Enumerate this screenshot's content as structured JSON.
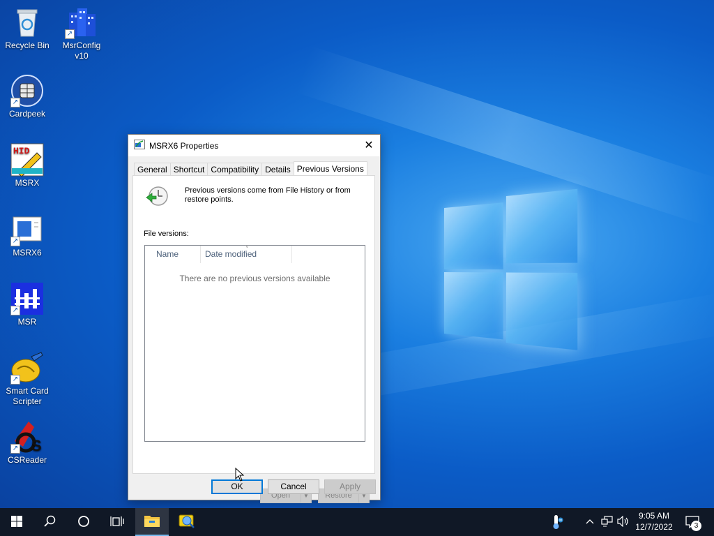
{
  "desktop": {
    "icons": [
      {
        "label": "Recycle Bin"
      },
      {
        "label": "MsrConfig v10"
      },
      {
        "label": "Cardpeek"
      },
      {
        "label": "MSRX"
      },
      {
        "label": "MSRX6"
      },
      {
        "label": "MSR"
      },
      {
        "label": "Smart Card Scripter"
      },
      {
        "label": "CSReader"
      }
    ],
    "msrx_icon_text": "HID",
    "csreader_icon_text": "S"
  },
  "dialog": {
    "title": "MSRX6 Properties",
    "close_glyph": "✕",
    "tabs": [
      {
        "label": "General"
      },
      {
        "label": "Shortcut"
      },
      {
        "label": "Compatibility"
      },
      {
        "label": "Details"
      },
      {
        "label": "Previous Versions",
        "active": true
      }
    ],
    "info_text": "Previous versions come from File History or from restore points.",
    "file_versions_label": "File versions:",
    "columns": [
      {
        "label": "Name"
      },
      {
        "label": "Date modified"
      }
    ],
    "empty_message": "There are no previous versions available",
    "open_label": "Open",
    "restore_label": "Restore",
    "ok_label": "OK",
    "cancel_label": "Cancel",
    "apply_label": "Apply"
  },
  "taskbar": {
    "clock_time": "9:05 AM",
    "clock_date": "12/7/2022",
    "notification_count": "3"
  },
  "colors": {
    "accent": "#0078d7",
    "taskbar_bg": "#101826"
  }
}
